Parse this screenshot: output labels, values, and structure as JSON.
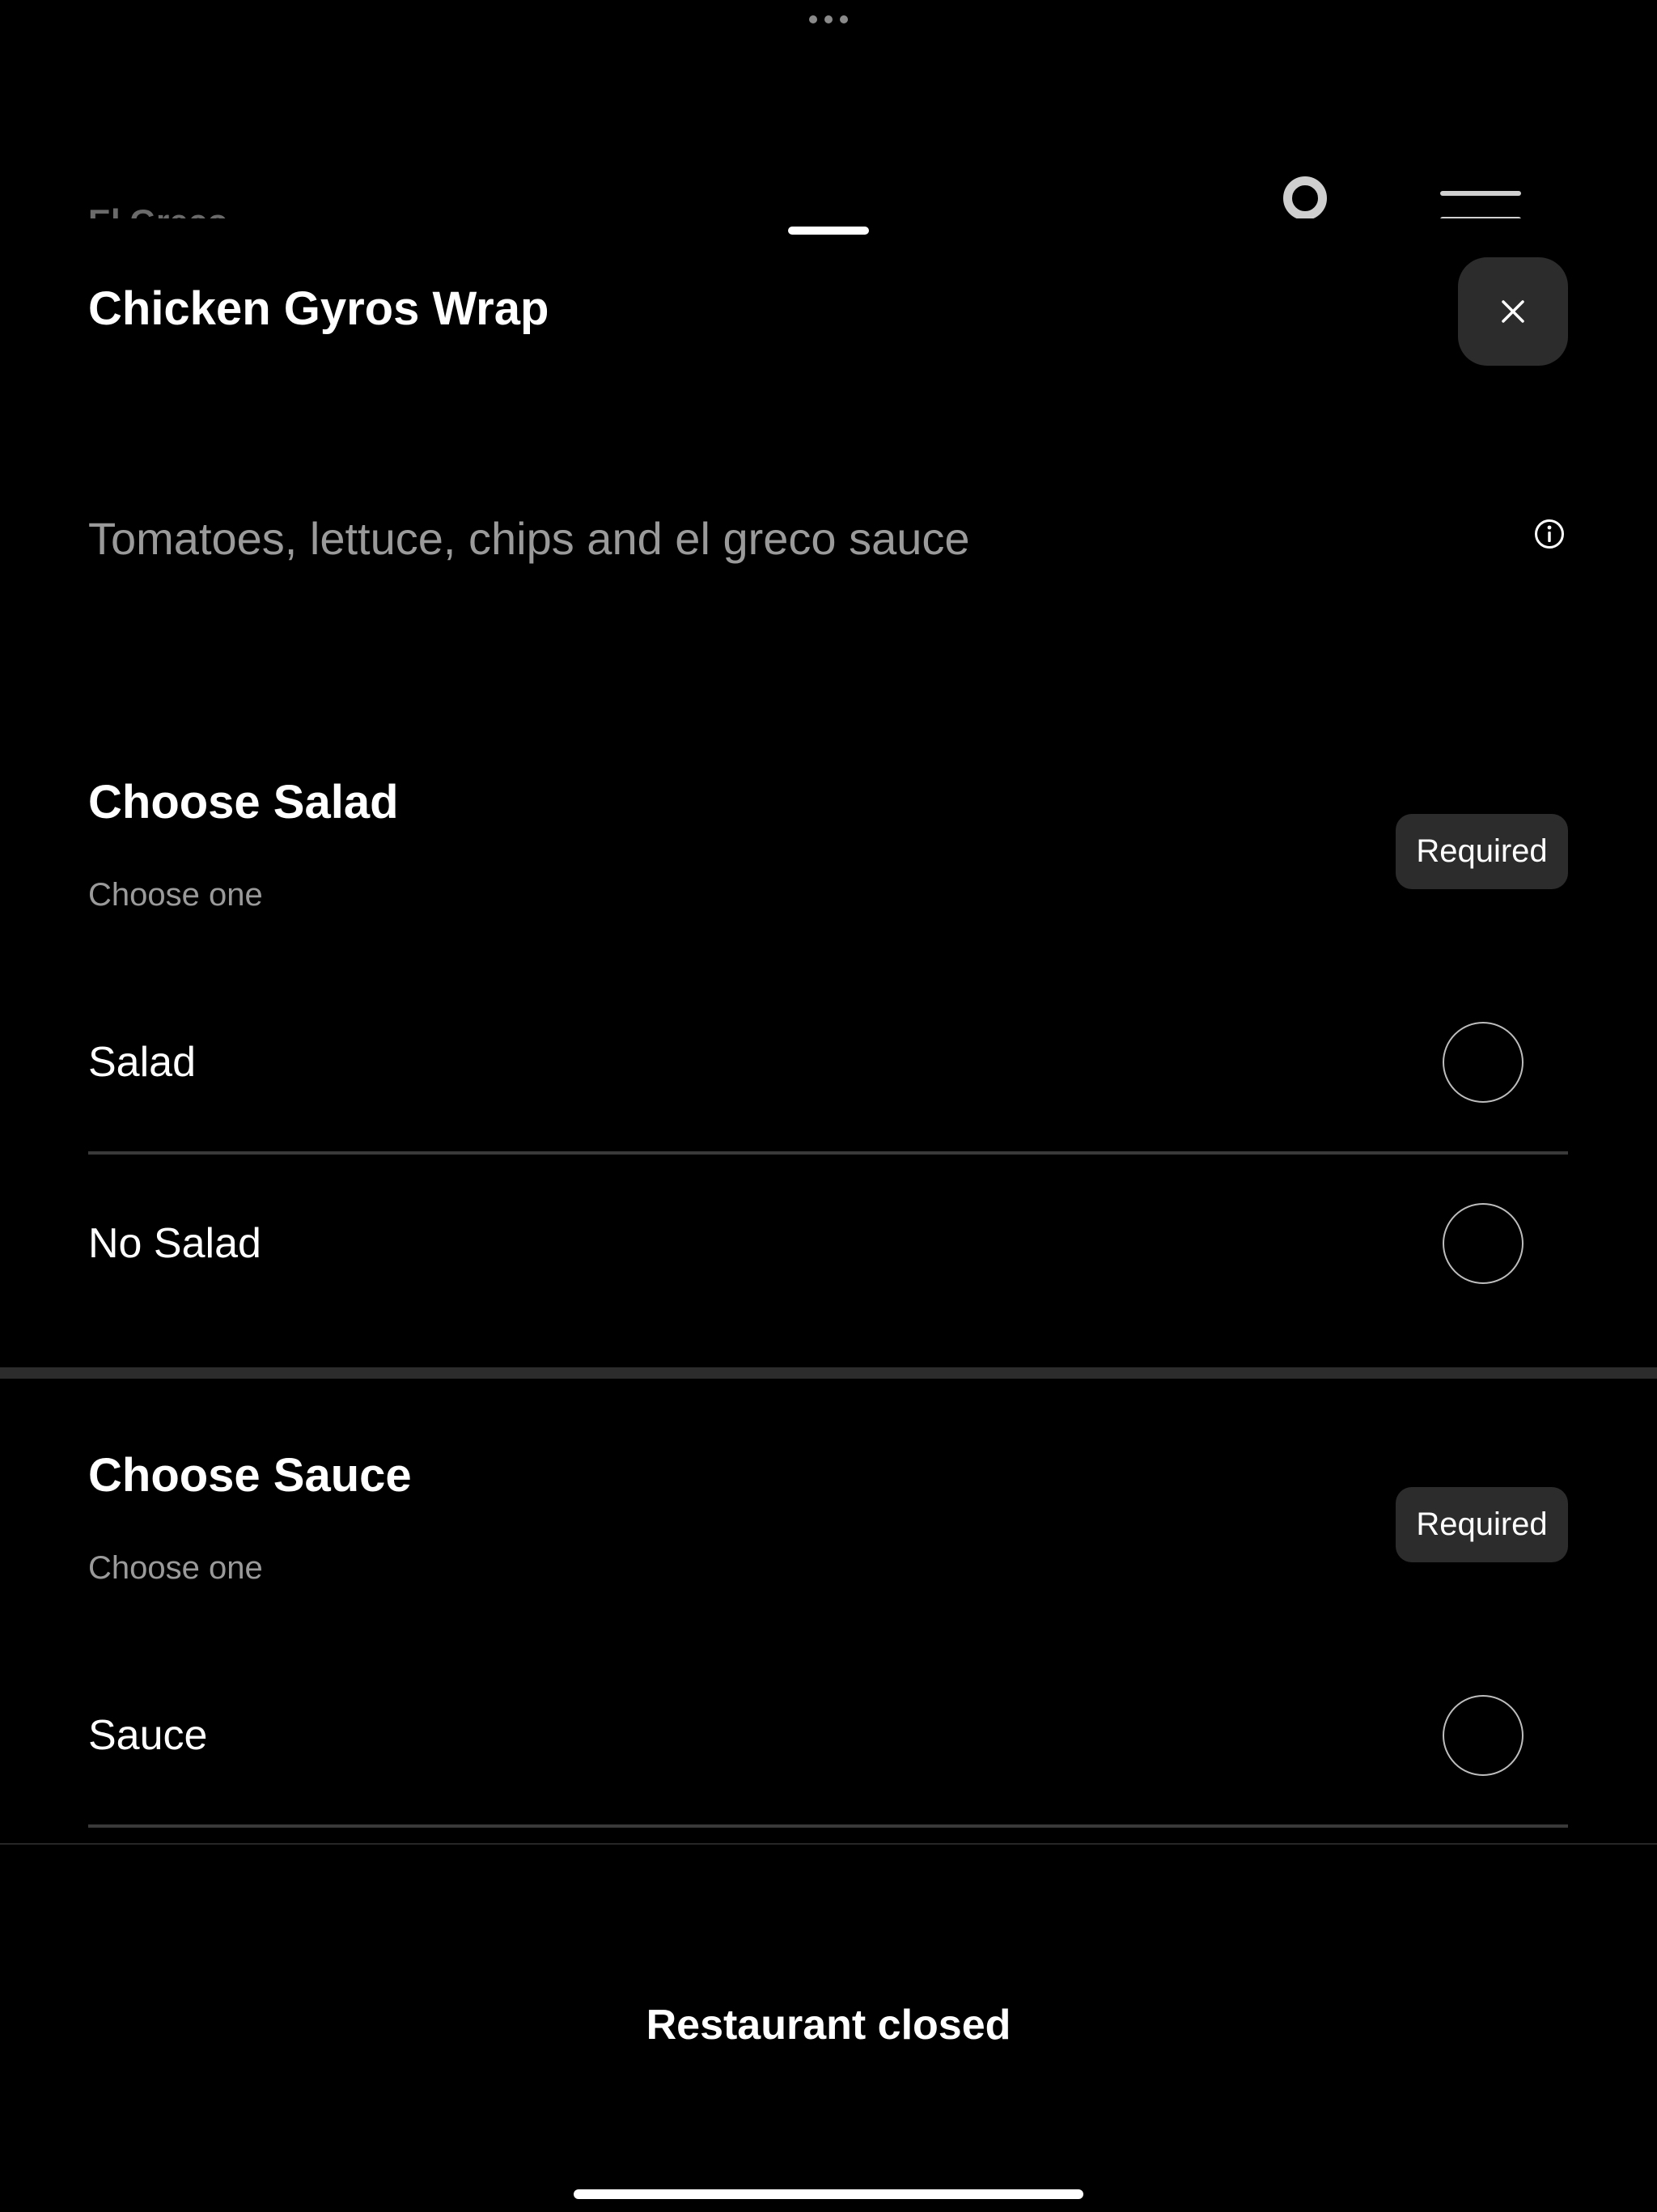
{
  "background": {
    "restaurant_name": "El Greco"
  },
  "item": {
    "title": "Chicken Gyros Wrap",
    "description": "Tomatoes, lettuce, chips and el greco sauce"
  },
  "sections": [
    {
      "title": "Choose Salad",
      "subtitle": "Choose one",
      "badge": "Required",
      "options": [
        {
          "label": "Salad",
          "selected": false
        },
        {
          "label": "No Salad",
          "selected": false
        }
      ]
    },
    {
      "title": "Choose Sauce",
      "subtitle": "Choose one",
      "badge": "Required",
      "options": [
        {
          "label": "Sauce",
          "selected": false
        }
      ]
    }
  ],
  "footer": {
    "status": "Restaurant closed"
  },
  "icons": {
    "close": "close-icon",
    "info": "info-icon",
    "loader": "loading-spinner-icon",
    "menu": "menu-icon"
  },
  "colors": {
    "background": "#000000",
    "surface": "#2c2c2c",
    "muted_text": "#9a9a9a",
    "divider": "#3a3a3a"
  }
}
